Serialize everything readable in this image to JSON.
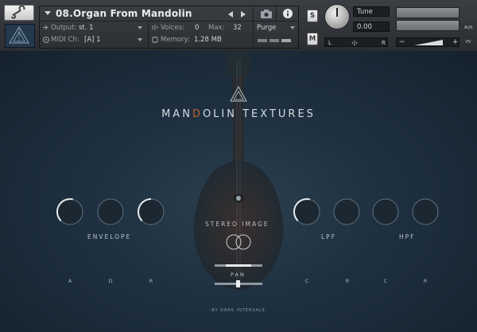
{
  "header": {
    "instrument_name": "08.Organ From Mandolin",
    "output_label": "Output:",
    "output_value": "st. 1",
    "voices_label": "Voices:",
    "voices_value": "0",
    "max_label": "Max:",
    "max_value": "32",
    "purge_label": "Purge",
    "midi_label": "MIDI Ch:",
    "midi_value": "[A]  1",
    "memory_label": "Memory:",
    "memory_value": "1.28 MB",
    "solo_label": "S",
    "mute_label": "M",
    "tune_label": "Tune",
    "tune_value": "0.00",
    "pan_left": "L",
    "pan_center": "‹|›",
    "pan_right": "R",
    "vol_minus": "−",
    "vol_plus": "+",
    "aux_label": "AUX",
    "pv_label": "PV"
  },
  "stage": {
    "title_pre": "MAN",
    "title_o": "D",
    "title_post": "OLIN TEXTURES",
    "envelope_label": "ENVELOPE",
    "stereo_label": "STEREO IMAGE",
    "pan_label": "PAN",
    "lpf_label": "LPF",
    "hpf_label": "HPF",
    "knobs": {
      "attack": "A",
      "decay": "D",
      "release": "R",
      "lpf_cutoff": "C",
      "lpf_res": "R",
      "hpf_cutoff": "C",
      "hpf_res": "R"
    },
    "footer": "BY DARK INTERVALS"
  },
  "colors": {
    "accent_orange": "#c4622e",
    "background": "#1b2a36",
    "knob_arc": "#e8ecef"
  }
}
